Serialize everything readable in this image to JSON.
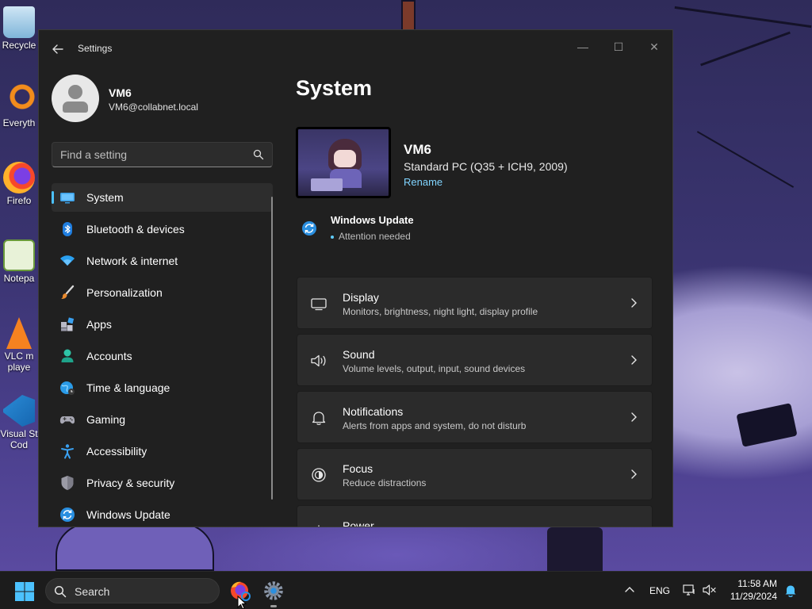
{
  "desktop": {
    "icons": [
      {
        "label": "Recycle",
        "icon": "recycle-bin-icon"
      },
      {
        "label": "Everyth",
        "icon": "everything-search-icon"
      },
      {
        "label": "Firefo",
        "icon": "firefox-icon"
      },
      {
        "label": "Notepa",
        "icon": "notepad-icon"
      },
      {
        "label": "VLC m",
        "label2": "playe",
        "icon": "vlc-icon"
      },
      {
        "label": "Visual St",
        "label2": "Cod",
        "icon": "vscode-icon"
      }
    ]
  },
  "window": {
    "title": "Settings",
    "controls": {
      "minimize": "—",
      "maximize": "☐",
      "close": "✕"
    }
  },
  "account": {
    "name": "VM6",
    "email": "VM6@collabnet.local"
  },
  "search": {
    "placeholder": "Find a setting"
  },
  "nav": [
    {
      "label": "System",
      "icon": "system-monitor-icon",
      "selected": true
    },
    {
      "label": "Bluetooth & devices",
      "icon": "bluetooth-icon"
    },
    {
      "label": "Network & internet",
      "icon": "wifi-icon"
    },
    {
      "label": "Personalization",
      "icon": "paintbrush-icon"
    },
    {
      "label": "Apps",
      "icon": "apps-icon"
    },
    {
      "label": "Accounts",
      "icon": "accounts-icon"
    },
    {
      "label": "Time & language",
      "icon": "globe-clock-icon"
    },
    {
      "label": "Gaming",
      "icon": "gamepad-icon"
    },
    {
      "label": "Accessibility",
      "icon": "accessibility-icon"
    },
    {
      "label": "Privacy & security",
      "icon": "shield-icon"
    },
    {
      "label": "Windows Update",
      "icon": "windows-update-icon"
    }
  ],
  "main": {
    "title": "System",
    "device": {
      "name": "VM6",
      "model": "Standard PC (Q35 + ICH9, 2009)",
      "rename": "Rename"
    },
    "windows_update": {
      "title": "Windows Update",
      "status": "Attention needed"
    },
    "cards": [
      {
        "title": "Display",
        "desc": "Monitors, brightness, night light, display profile",
        "icon": "display-icon"
      },
      {
        "title": "Sound",
        "desc": "Volume levels, output, input, sound devices",
        "icon": "speaker-icon"
      },
      {
        "title": "Notifications",
        "desc": "Alerts from apps and system, do not disturb",
        "icon": "bell-icon"
      },
      {
        "title": "Focus",
        "desc": "Reduce distractions",
        "icon": "focus-icon"
      },
      {
        "title": "Power",
        "desc": "",
        "icon": "power-icon"
      }
    ]
  },
  "taskbar": {
    "search_label": "Search",
    "language": "ENG",
    "time": "11:58 AM",
    "date": "11/29/2024"
  },
  "colors": {
    "accent": "#4cc2ff",
    "link": "#80d4ff",
    "window_bg": "#202020",
    "card_bg": "#2b2b2b",
    "taskbar_bg": "#1c1c1c"
  }
}
